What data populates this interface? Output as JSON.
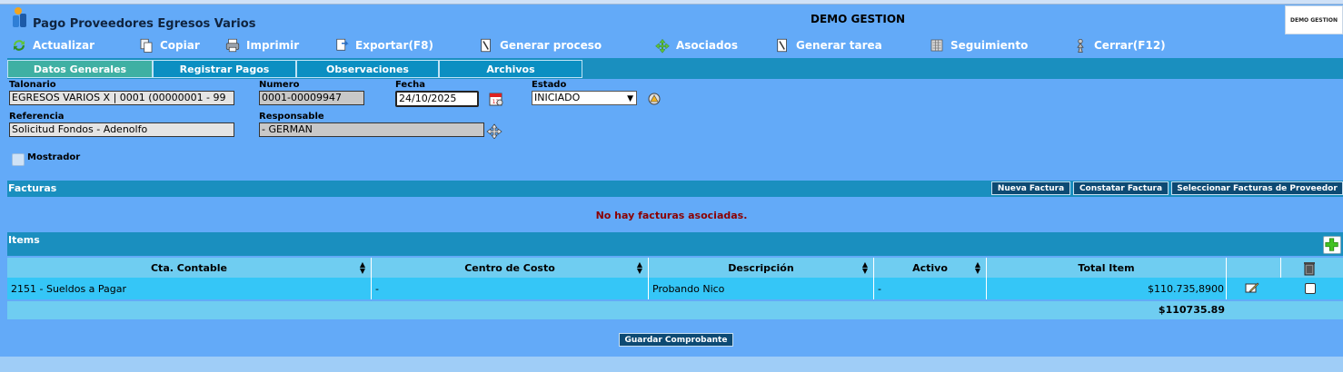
{
  "header": {
    "title": "Pago Proveedores Egresos Varios",
    "company": "DEMO GESTION",
    "brand": "DEMO GESTION"
  },
  "toolbar": {
    "actualizar": "Actualizar",
    "copiar": "Copiar",
    "imprimir": "Imprimir",
    "exportar": "Exportar(F8)",
    "generar_proceso": "Generar proceso",
    "asociados": "Asociados",
    "generar_tarea": "Generar tarea",
    "seguimiento": "Seguimiento",
    "cerrar": "Cerrar(F12)"
  },
  "tabs": [
    {
      "label": "Datos Generales",
      "active": true
    },
    {
      "label": "Registrar Pagos",
      "active": false
    },
    {
      "label": "Observaciones",
      "active": false
    },
    {
      "label": "Archivos",
      "active": false
    }
  ],
  "form": {
    "talonario_label": "Talonario",
    "talonario_value": "EGRESOS VARIOS X | 0001 (00000001 - 99",
    "numero_label": "Numero",
    "numero_value": "0001-00009947",
    "fecha_label": "Fecha",
    "fecha_value": "24/10/2025",
    "estado_label": "Estado",
    "estado_value": "INICIADO",
    "referencia_label": "Referencia",
    "referencia_value": "Solicitud Fondos - Adenolfo",
    "responsable_label": "Responsable",
    "responsable_value": "- GERMAN",
    "mostrador_label": "Mostrador",
    "mostrador_checked": false
  },
  "facturas": {
    "title": "Facturas",
    "nueva": "Nueva Factura",
    "constatar": "Constatar Factura",
    "seleccionar": "Seleccionar Facturas de Proveedor",
    "empty_message": "No hay facturas asociadas."
  },
  "items": {
    "title": "Items",
    "columns": [
      "Cta. Contable",
      "Centro de Costo",
      "Descripción",
      "Activo",
      "Total Item"
    ],
    "rows": [
      {
        "cta": "2151 - Sueldos a Pagar",
        "centro": "-",
        "descripcion": "Probando Nico",
        "activo": "-",
        "total": "$110.735,8900"
      }
    ],
    "grand_total": "$110735.89"
  },
  "actions": {
    "guardar": "Guardar Comprobante"
  },
  "colors": {
    "background": "#63aaf8",
    "section_bar": "#1a8fbf",
    "active_tab": "#3fb0a3",
    "error_text": "#8b0000"
  }
}
